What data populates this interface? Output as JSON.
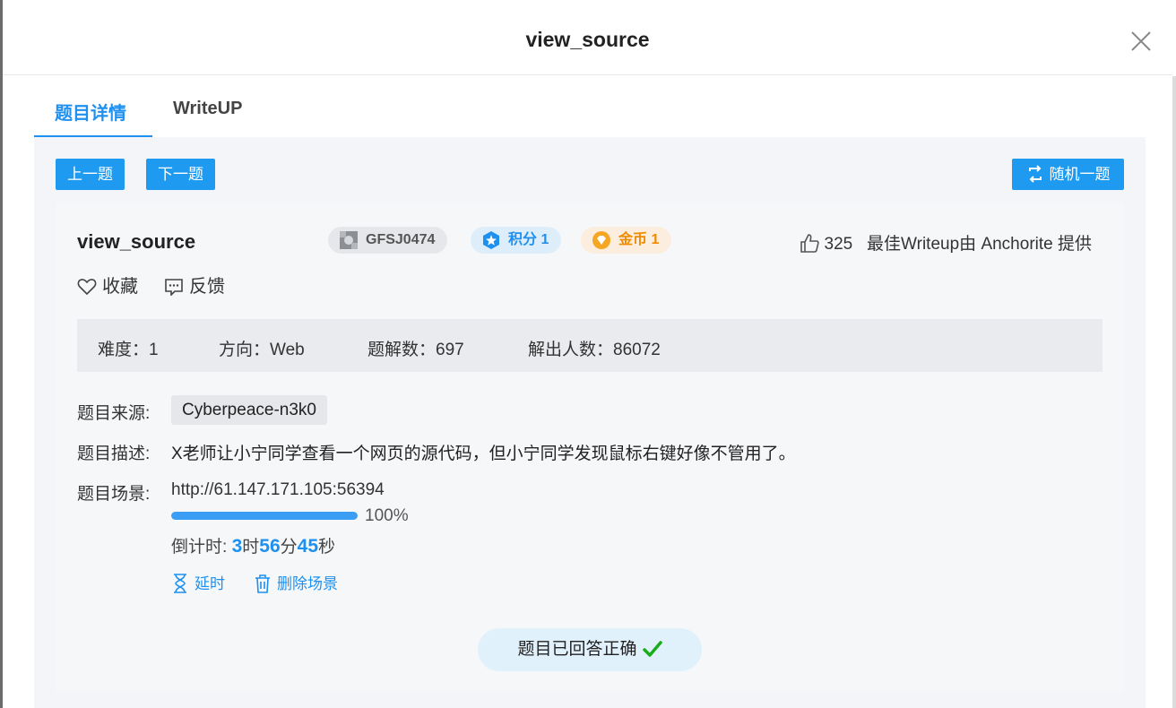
{
  "modal": {
    "title": "view_source"
  },
  "tabs": [
    {
      "label": "题目详情",
      "active": true
    },
    {
      "label": "WriteUP",
      "active": false
    }
  ],
  "nav": {
    "prev_label": "上一题",
    "next_label": "下一题",
    "random_label": "随机一题"
  },
  "challenge": {
    "title": "view_source",
    "code": "GFSJ0474",
    "score_label": "积分 1",
    "coin_label": "金币 1",
    "likes": "325",
    "best_writeup": "最佳Writeup由 Anchorite 提供",
    "favorite_label": "收藏",
    "feedback_label": "反馈"
  },
  "stats": {
    "difficulty": "难度：1",
    "category": "方向：Web",
    "solves_writeups": "题解数：697",
    "solvers": "解出人数：86072"
  },
  "details": {
    "source_label": "题目来源:",
    "source_value": "Cyberpeace-n3k0",
    "desc_label": "题目描述:",
    "desc_value": "X老师让小宁同学查看一个网页的源代码，但小宁同学发现鼠标右键好像不管用了。",
    "scene_label": "题目场景:",
    "scene_url": "http://61.147.171.105:56394",
    "progress_percent": 100,
    "progress_text": "100%",
    "countdown_prefix": "倒计时: ",
    "countdown_h": "3",
    "countdown_h_unit": "时",
    "countdown_m": "56",
    "countdown_m_unit": "分",
    "countdown_s": "45",
    "countdown_s_unit": "秒",
    "extend_label": "延时",
    "delete_label": "删除场景"
  },
  "status": {
    "answered_label": "题目已回答正确"
  },
  "colors": {
    "accent": "#1e90ef",
    "success": "#1aad19",
    "coin": "#f08a00"
  }
}
